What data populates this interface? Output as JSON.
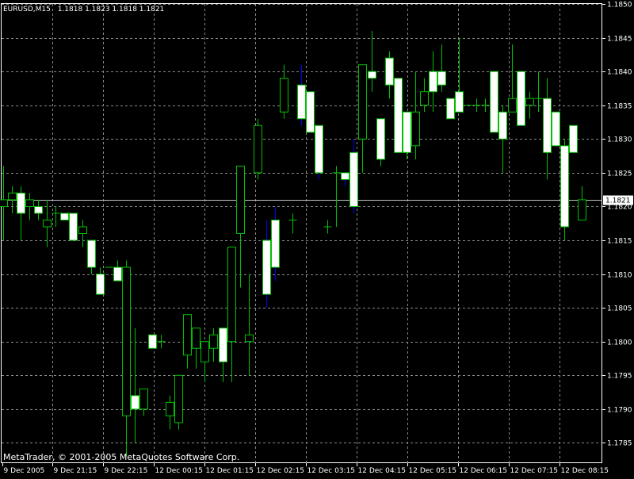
{
  "header": {
    "symbol_tf": "EURUSD,M15",
    "ohlc": "1.1818 1.1823 1.1818 1.1821"
  },
  "footer": {
    "copyright": "MetaTrader, © 2001-2005 MetaQuotes Software Corp."
  },
  "colors": {
    "background": "#000000",
    "grid": "#8a8a8a",
    "bull": "#00c000",
    "bull_body": "#ffffff",
    "bear_wick": "#ff0000",
    "blue_wick": "#0000ff",
    "axis_text": "#ffffff",
    "price_line": "#c0c0c0"
  },
  "chart_data": {
    "type": "candlestick",
    "title": "EURUSD,M15",
    "ylim": [
      1.1782,
      1.185
    ],
    "y_ticks": [
      "1.1785",
      "1.1790",
      "1.1795",
      "1.1800",
      "1.1805",
      "1.1810",
      "1.1815",
      "1.1820",
      "1.1825",
      "1.1830",
      "1.1835",
      "1.1840",
      "1.1845",
      "1.1850"
    ],
    "x_ticks": [
      "9 Dec 2005",
      "9 Dec 21:15",
      "9 Dec 22:15",
      "12 Dec 00:15",
      "12 Dec 01:15",
      "12 Dec 02:15",
      "12 Dec 03:15",
      "12 Dec 04:15",
      "12 Dec 05:15",
      "12 Dec 06:15",
      "12 Dec 07:15",
      "12 Dec 08:15"
    ],
    "current_price": "1.1821",
    "grid": true,
    "candles": [
      {
        "o": 1.182,
        "h": 1.1826,
        "l": 1.1815,
        "c": 1.1821
      },
      {
        "o": 1.1821,
        "h": 1.1823,
        "l": 1.1819,
        "c": 1.1822
      },
      {
        "o": 1.1822,
        "h": 1.1823,
        "l": 1.1815,
        "c": 1.1819
      },
      {
        "o": 1.182,
        "h": 1.1822,
        "l": 1.1818,
        "c": 1.1821
      },
      {
        "o": 1.182,
        "h": 1.1821,
        "l": 1.1818,
        "c": 1.1819
      },
      {
        "o": 1.1817,
        "h": 1.1821,
        "l": 1.1814,
        "c": 1.1818
      },
      {
        "o": 1.1819,
        "h": 1.182,
        "l": 1.1817,
        "c": 1.1819
      },
      {
        "o": 1.1819,
        "h": 1.1818,
        "l": 1.1818,
        "c": 1.1818
      },
      {
        "o": 1.1819,
        "h": 1.1819,
        "l": 1.1815,
        "c": 1.1815
      },
      {
        "o": 1.1816,
        "h": 1.1818,
        "l": 1.1814,
        "c": 1.1817
      },
      {
        "o": 1.1815,
        "h": 1.1814,
        "l": 1.181,
        "c": 1.1811
      },
      {
        "o": 1.181,
        "h": 1.1811,
        "l": 1.1807,
        "c": 1.1807
      },
      {
        "o": 1.1811,
        "h": 1.1811,
        "l": 1.1811,
        "c": 1.1811
      },
      {
        "o": 1.1811,
        "h": 1.1812,
        "l": 1.1809,
        "c": 1.1809
      },
      {
        "o": 1.1789,
        "h": 1.1812,
        "l": 1.1783,
        "c": 1.1811
      },
      {
        "o": 1.1792,
        "h": 1.1802,
        "l": 1.1785,
        "c": 1.179
      },
      {
        "o": 1.179,
        "h": 1.1793,
        "l": 1.1789,
        "c": 1.1793
      },
      {
        "o": 1.1801,
        "h": 1.1801,
        "l": 1.1799,
        "c": 1.1799
      },
      {
        "o": 1.18,
        "h": 1.1801,
        "l": 1.1799,
        "c": 1.18
      },
      {
        "o": 1.1789,
        "h": 1.1792,
        "l": 1.1787,
        "c": 1.1791
      },
      {
        "o": 1.1788,
        "h": 1.1795,
        "l": 1.1787,
        "c": 1.1795
      },
      {
        "o": 1.1798,
        "h": 1.1804,
        "l": 1.1796,
        "c": 1.1804
      },
      {
        "o": 1.1799,
        "h": 1.1802,
        "l": 1.1796,
        "c": 1.1802
      },
      {
        "o": 1.1797,
        "h": 1.18,
        "l": 1.1794,
        "c": 1.18
      },
      {
        "o": 1.1799,
        "h": 1.1802,
        "l": 1.1797,
        "c": 1.1801
      },
      {
        "o": 1.1802,
        "h": 1.1802,
        "l": 1.1794,
        "c": 1.1797
      },
      {
        "o": 1.18,
        "h": 1.1814,
        "l": 1.1794,
        "c": 1.1814
      },
      {
        "o": 1.1816,
        "h": 1.1826,
        "l": 1.1808,
        "c": 1.1826
      },
      {
        "o": 1.18,
        "h": 1.181,
        "l": 1.1795,
        "c": 1.1801
      },
      {
        "o": 1.1825,
        "h": 1.1833,
        "l": 1.1824,
        "c": 1.1832
      },
      {
        "o": 1.1815,
        "h": 1.1818,
        "l": 1.1805,
        "c": 1.1807
      },
      {
        "o": 1.1818,
        "h": 1.182,
        "l": 1.1809,
        "c": 1.1811
      },
      {
        "o": 1.1834,
        "h": 1.1841,
        "l": 1.1833,
        "c": 1.1839
      },
      {
        "o": 1.1818,
        "h": 1.1819,
        "l": 1.1816,
        "c": 1.1818
      },
      {
        "o": 1.1838,
        "h": 1.1841,
        "l": 1.1832,
        "c": 1.1833
      },
      {
        "o": 1.1837,
        "h": 1.1837,
        "l": 1.1831,
        "c": 1.1831
      },
      {
        "o": 1.1832,
        "h": 1.1832,
        "l": 1.1824,
        "c": 1.1825
      },
      {
        "o": 1.1817,
        "h": 1.1818,
        "l": 1.1816,
        "c": 1.1817
      },
      {
        "o": 1.1825,
        "h": 1.1826,
        "l": 1.1817,
        "c": 1.1825
      },
      {
        "o": 1.1825,
        "h": 1.1825,
        "l": 1.1823,
        "c": 1.1824
      },
      {
        "o": 1.1828,
        "h": 1.183,
        "l": 1.1819,
        "c": 1.182
      },
      {
        "o": 1.183,
        "h": 1.1841,
        "l": 1.1825,
        "c": 1.1841
      },
      {
        "o": 1.184,
        "h": 1.1846,
        "l": 1.1837,
        "c": 1.1839
      },
      {
        "o": 1.1833,
        "h": 1.1833,
        "l": 1.1826,
        "c": 1.1827
      },
      {
        "o": 1.1842,
        "h": 1.1843,
        "l": 1.1836,
        "c": 1.1838
      },
      {
        "o": 1.1839,
        "h": 1.1839,
        "l": 1.1828,
        "c": 1.1828
      },
      {
        "o": 1.1834,
        "h": 1.1834,
        "l": 1.1827,
        "c": 1.1828
      },
      {
        "o": 1.1829,
        "h": 1.184,
        "l": 1.1827,
        "c": 1.1834
      },
      {
        "o": 1.1835,
        "h": 1.1839,
        "l": 1.1834,
        "c": 1.1837
      },
      {
        "o": 1.184,
        "h": 1.1843,
        "l": 1.1834,
        "c": 1.1837
      },
      {
        "o": 1.184,
        "h": 1.1844,
        "l": 1.1837,
        "c": 1.1838
      },
      {
        "o": 1.1836,
        "h": 1.1836,
        "l": 1.1833,
        "c": 1.1833
      },
      {
        "o": 1.1837,
        "h": 1.1845,
        "l": 1.1834,
        "c": 1.1834
      },
      {
        "o": 1.1835,
        "h": 1.1835,
        "l": 1.1835,
        "c": 1.1835
      },
      {
        "o": 1.1835,
        "h": 1.1836,
        "l": 1.1834,
        "c": 1.1835
      },
      {
        "o": 1.1835,
        "h": 1.1836,
        "l": 1.1834,
        "c": 1.1835
      },
      {
        "o": 1.184,
        "h": 1.184,
        "l": 1.1831,
        "c": 1.1831
      },
      {
        "o": 1.1834,
        "h": 1.1835,
        "l": 1.1825,
        "c": 1.183
      },
      {
        "o": 1.1834,
        "h": 1.1844,
        "l": 1.1834,
        "c": 1.1836
      },
      {
        "o": 1.184,
        "h": 1.184,
        "l": 1.1834,
        "c": 1.1832
      },
      {
        "o": 1.1835,
        "h": 1.1837,
        "l": 1.1833,
        "c": 1.1836
      },
      {
        "o": 1.1836,
        "h": 1.184,
        "l": 1.1834,
        "c": 1.1836
      },
      {
        "o": 1.1836,
        "h": 1.1839,
        "l": 1.1824,
        "c": 1.1828
      },
      {
        "o": 1.1834,
        "h": 1.1834,
        "l": 1.1829,
        "c": 1.1829
      },
      {
        "o": 1.1829,
        "h": 1.183,
        "l": 1.1815,
        "c": 1.1817
      },
      {
        "o": 1.1832,
        "h": 1.1832,
        "l": 1.1828,
        "c": 1.1828
      },
      {
        "o": 1.1818,
        "h": 1.1823,
        "l": 1.1818,
        "c": 1.1821
      }
    ]
  }
}
